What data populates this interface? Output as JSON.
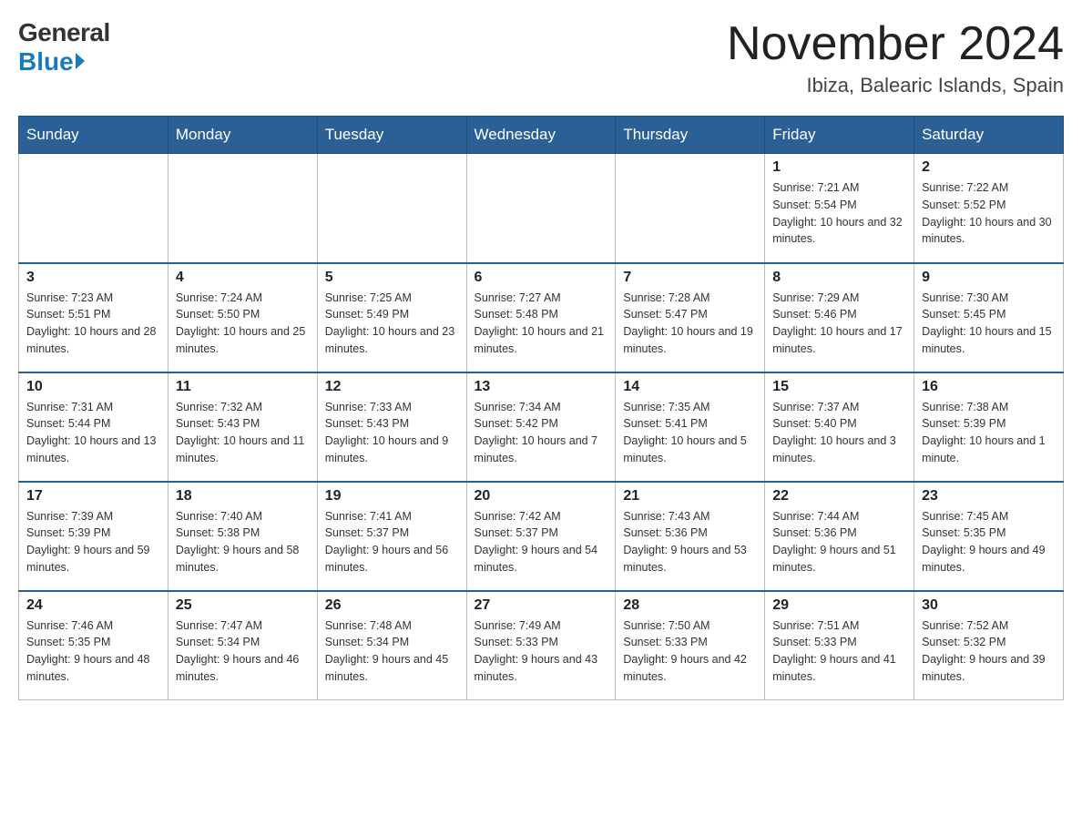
{
  "header": {
    "logo_general": "General",
    "logo_blue": "Blue",
    "month_title": "November 2024",
    "location": "Ibiza, Balearic Islands, Spain"
  },
  "days_of_week": [
    "Sunday",
    "Monday",
    "Tuesday",
    "Wednesday",
    "Thursday",
    "Friday",
    "Saturday"
  ],
  "weeks": [
    [
      {
        "day": "",
        "info": ""
      },
      {
        "day": "",
        "info": ""
      },
      {
        "day": "",
        "info": ""
      },
      {
        "day": "",
        "info": ""
      },
      {
        "day": "",
        "info": ""
      },
      {
        "day": "1",
        "info": "Sunrise: 7:21 AM\nSunset: 5:54 PM\nDaylight: 10 hours and 32 minutes."
      },
      {
        "day": "2",
        "info": "Sunrise: 7:22 AM\nSunset: 5:52 PM\nDaylight: 10 hours and 30 minutes."
      }
    ],
    [
      {
        "day": "3",
        "info": "Sunrise: 7:23 AM\nSunset: 5:51 PM\nDaylight: 10 hours and 28 minutes."
      },
      {
        "day": "4",
        "info": "Sunrise: 7:24 AM\nSunset: 5:50 PM\nDaylight: 10 hours and 25 minutes."
      },
      {
        "day": "5",
        "info": "Sunrise: 7:25 AM\nSunset: 5:49 PM\nDaylight: 10 hours and 23 minutes."
      },
      {
        "day": "6",
        "info": "Sunrise: 7:27 AM\nSunset: 5:48 PM\nDaylight: 10 hours and 21 minutes."
      },
      {
        "day": "7",
        "info": "Sunrise: 7:28 AM\nSunset: 5:47 PM\nDaylight: 10 hours and 19 minutes."
      },
      {
        "day": "8",
        "info": "Sunrise: 7:29 AM\nSunset: 5:46 PM\nDaylight: 10 hours and 17 minutes."
      },
      {
        "day": "9",
        "info": "Sunrise: 7:30 AM\nSunset: 5:45 PM\nDaylight: 10 hours and 15 minutes."
      }
    ],
    [
      {
        "day": "10",
        "info": "Sunrise: 7:31 AM\nSunset: 5:44 PM\nDaylight: 10 hours and 13 minutes."
      },
      {
        "day": "11",
        "info": "Sunrise: 7:32 AM\nSunset: 5:43 PM\nDaylight: 10 hours and 11 minutes."
      },
      {
        "day": "12",
        "info": "Sunrise: 7:33 AM\nSunset: 5:43 PM\nDaylight: 10 hours and 9 minutes."
      },
      {
        "day": "13",
        "info": "Sunrise: 7:34 AM\nSunset: 5:42 PM\nDaylight: 10 hours and 7 minutes."
      },
      {
        "day": "14",
        "info": "Sunrise: 7:35 AM\nSunset: 5:41 PM\nDaylight: 10 hours and 5 minutes."
      },
      {
        "day": "15",
        "info": "Sunrise: 7:37 AM\nSunset: 5:40 PM\nDaylight: 10 hours and 3 minutes."
      },
      {
        "day": "16",
        "info": "Sunrise: 7:38 AM\nSunset: 5:39 PM\nDaylight: 10 hours and 1 minute."
      }
    ],
    [
      {
        "day": "17",
        "info": "Sunrise: 7:39 AM\nSunset: 5:39 PM\nDaylight: 9 hours and 59 minutes."
      },
      {
        "day": "18",
        "info": "Sunrise: 7:40 AM\nSunset: 5:38 PM\nDaylight: 9 hours and 58 minutes."
      },
      {
        "day": "19",
        "info": "Sunrise: 7:41 AM\nSunset: 5:37 PM\nDaylight: 9 hours and 56 minutes."
      },
      {
        "day": "20",
        "info": "Sunrise: 7:42 AM\nSunset: 5:37 PM\nDaylight: 9 hours and 54 minutes."
      },
      {
        "day": "21",
        "info": "Sunrise: 7:43 AM\nSunset: 5:36 PM\nDaylight: 9 hours and 53 minutes."
      },
      {
        "day": "22",
        "info": "Sunrise: 7:44 AM\nSunset: 5:36 PM\nDaylight: 9 hours and 51 minutes."
      },
      {
        "day": "23",
        "info": "Sunrise: 7:45 AM\nSunset: 5:35 PM\nDaylight: 9 hours and 49 minutes."
      }
    ],
    [
      {
        "day": "24",
        "info": "Sunrise: 7:46 AM\nSunset: 5:35 PM\nDaylight: 9 hours and 48 minutes."
      },
      {
        "day": "25",
        "info": "Sunrise: 7:47 AM\nSunset: 5:34 PM\nDaylight: 9 hours and 46 minutes."
      },
      {
        "day": "26",
        "info": "Sunrise: 7:48 AM\nSunset: 5:34 PM\nDaylight: 9 hours and 45 minutes."
      },
      {
        "day": "27",
        "info": "Sunrise: 7:49 AM\nSunset: 5:33 PM\nDaylight: 9 hours and 43 minutes."
      },
      {
        "day": "28",
        "info": "Sunrise: 7:50 AM\nSunset: 5:33 PM\nDaylight: 9 hours and 42 minutes."
      },
      {
        "day": "29",
        "info": "Sunrise: 7:51 AM\nSunset: 5:33 PM\nDaylight: 9 hours and 41 minutes."
      },
      {
        "day": "30",
        "info": "Sunrise: 7:52 AM\nSunset: 5:32 PM\nDaylight: 9 hours and 39 minutes."
      }
    ]
  ]
}
